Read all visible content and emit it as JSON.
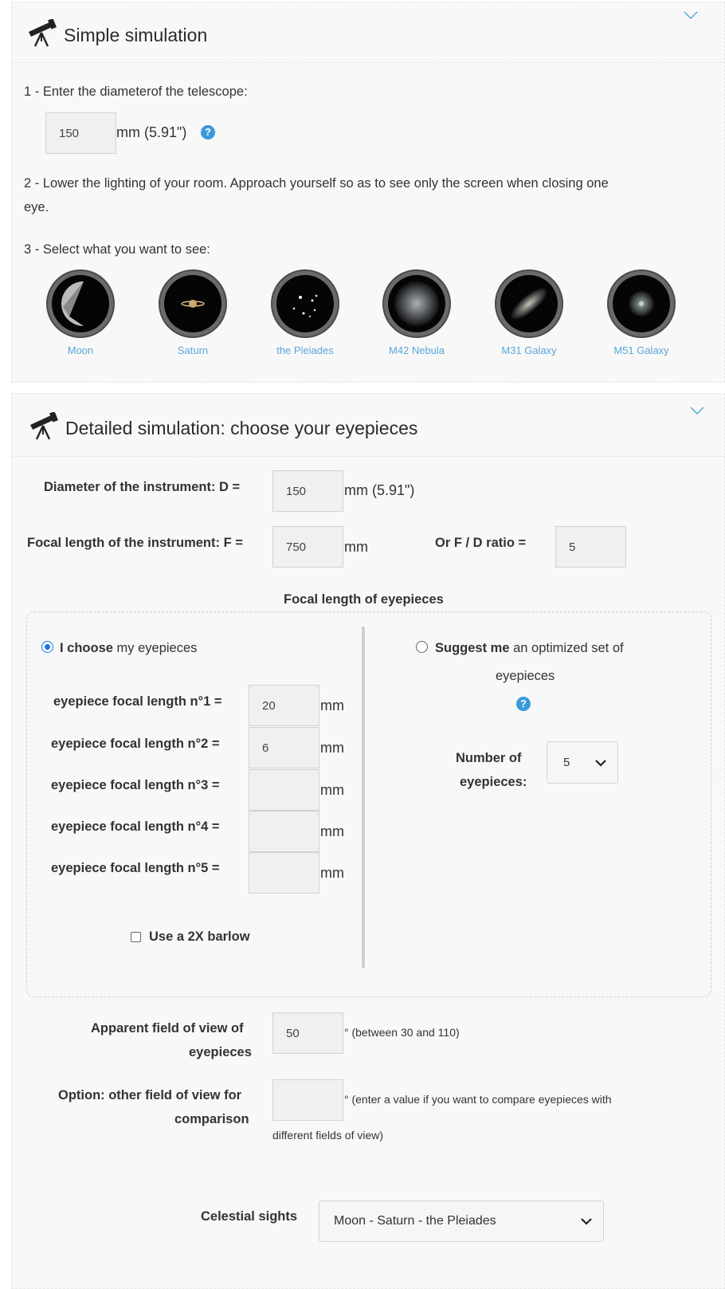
{
  "simple": {
    "title": "Simple simulation",
    "step1": "1 - Enter the diameterof the telescope:",
    "diameter_value": "150",
    "diameter_unit": "mm (5.91\")",
    "step2_line1": "2 - Lower the lighting of your room. Approach yourself so as to see only the screen when closing one",
    "step2_line2": "eye.",
    "step3": "3 - Select what you want to see:",
    "objects": [
      {
        "label": "Moon"
      },
      {
        "label": "Saturn"
      },
      {
        "label": "the Pleiades"
      },
      {
        "label": "M42 Nebula"
      },
      {
        "label": "M31 Galaxy"
      },
      {
        "label": "M51 Galaxy"
      }
    ]
  },
  "detailed": {
    "title": "Detailed simulation: choose your eyepieces",
    "diameter_label": "Diameter of the instrument: D =",
    "diameter_value": "150",
    "diameter_unit": "mm (5.91\")",
    "focal_label": "Focal length of the instrument: F =",
    "focal_value": "750",
    "focal_unit": "mm",
    "ratio_label": "Or F / D ratio =",
    "ratio_value": "5",
    "eyepieces_heading": "Focal length of eyepieces",
    "choose_bold": "I choose",
    "choose_rest": " my eyepieces",
    "suggest_bold": "Suggest me",
    "suggest_rest": " an optimized set of",
    "suggest_line2": "eyepieces",
    "eyepieces": [
      {
        "label": "eyepiece focal length n°1 =",
        "value": "20"
      },
      {
        "label": "eyepiece focal length n°2 =",
        "value": "6"
      },
      {
        "label": "eyepiece focal length n°3 =",
        "value": ""
      },
      {
        "label": "eyepiece focal length n°4 =",
        "value": ""
      },
      {
        "label": "eyepiece focal length n°5 =",
        "value": ""
      }
    ],
    "eyepiece_unit": "mm",
    "number_label_1": "Number of",
    "number_label_2": "eyepieces:",
    "number_value": "5",
    "barlow_label": "Use a 2X barlow",
    "afov_label_1": "Apparent field of view of",
    "afov_label_2": "eyepieces",
    "afov_value": "50",
    "afov_note": "° (between 30 and 110)",
    "other_label_1": "Option: other field of view for",
    "other_label_2": "comparison",
    "other_value": "",
    "other_note_1": "° (enter a value if you want to compare eyepieces with",
    "other_note_2": "different fields of view)",
    "sights_label": "Celestial sights",
    "sights_value": "Moon - Saturn - the Pleiades"
  }
}
